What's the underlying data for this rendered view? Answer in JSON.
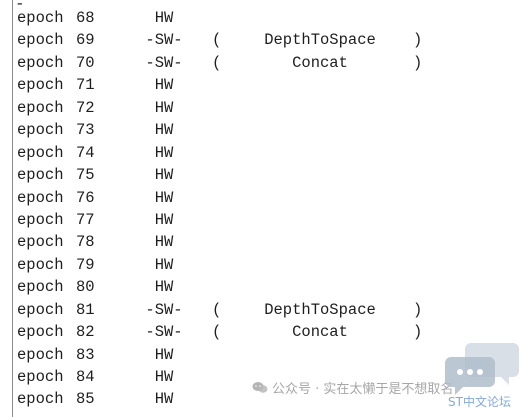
{
  "header": {
    "dash": "-"
  },
  "log": {
    "rows": [
      {
        "epoch": "epoch",
        "num": "68",
        "mode": "HW",
        "open": "",
        "op": "",
        "close": ""
      },
      {
        "epoch": "epoch",
        "num": "69",
        "mode": "-SW-",
        "open": "(",
        "op": "DepthToSpace",
        "close": ")"
      },
      {
        "epoch": "epoch",
        "num": "70",
        "mode": "-SW-",
        "open": "(",
        "op": "Concat",
        "close": ")"
      },
      {
        "epoch": "epoch",
        "num": "71",
        "mode": "HW",
        "open": "",
        "op": "",
        "close": ""
      },
      {
        "epoch": "epoch",
        "num": "72",
        "mode": "HW",
        "open": "",
        "op": "",
        "close": ""
      },
      {
        "epoch": "epoch",
        "num": "73",
        "mode": "HW",
        "open": "",
        "op": "",
        "close": ""
      },
      {
        "epoch": "epoch",
        "num": "74",
        "mode": "HW",
        "open": "",
        "op": "",
        "close": ""
      },
      {
        "epoch": "epoch",
        "num": "75",
        "mode": "HW",
        "open": "",
        "op": "",
        "close": ""
      },
      {
        "epoch": "epoch",
        "num": "76",
        "mode": "HW",
        "open": "",
        "op": "",
        "close": ""
      },
      {
        "epoch": "epoch",
        "num": "77",
        "mode": "HW",
        "open": "",
        "op": "",
        "close": ""
      },
      {
        "epoch": "epoch",
        "num": "78",
        "mode": "HW",
        "open": "",
        "op": "",
        "close": ""
      },
      {
        "epoch": "epoch",
        "num": "79",
        "mode": "HW",
        "open": "",
        "op": "",
        "close": ""
      },
      {
        "epoch": "epoch",
        "num": "80",
        "mode": "HW",
        "open": "",
        "op": "",
        "close": ""
      },
      {
        "epoch": "epoch",
        "num": "81",
        "mode": "-SW-",
        "open": "(",
        "op": "DepthToSpace",
        "close": ")"
      },
      {
        "epoch": "epoch",
        "num": "82",
        "mode": "-SW-",
        "open": "(",
        "op": "Concat",
        "close": ")"
      },
      {
        "epoch": "epoch",
        "num": "83",
        "mode": "HW",
        "open": "",
        "op": "",
        "close": ""
      },
      {
        "epoch": "epoch",
        "num": "84",
        "mode": "HW",
        "open": "",
        "op": "",
        "close": ""
      },
      {
        "epoch": "epoch",
        "num": "85",
        "mode": "HW",
        "open": "",
        "op": "",
        "close": ""
      }
    ]
  },
  "watermark": {
    "text": "公众号 · 实在太懒于是不想取名",
    "icon": "wechat-icon"
  },
  "logo": {
    "text": "ST中文论坛",
    "icon": "chat-bubble-icon",
    "bubble_color": "#c8d2dc",
    "text_color": "#78a0d2"
  }
}
